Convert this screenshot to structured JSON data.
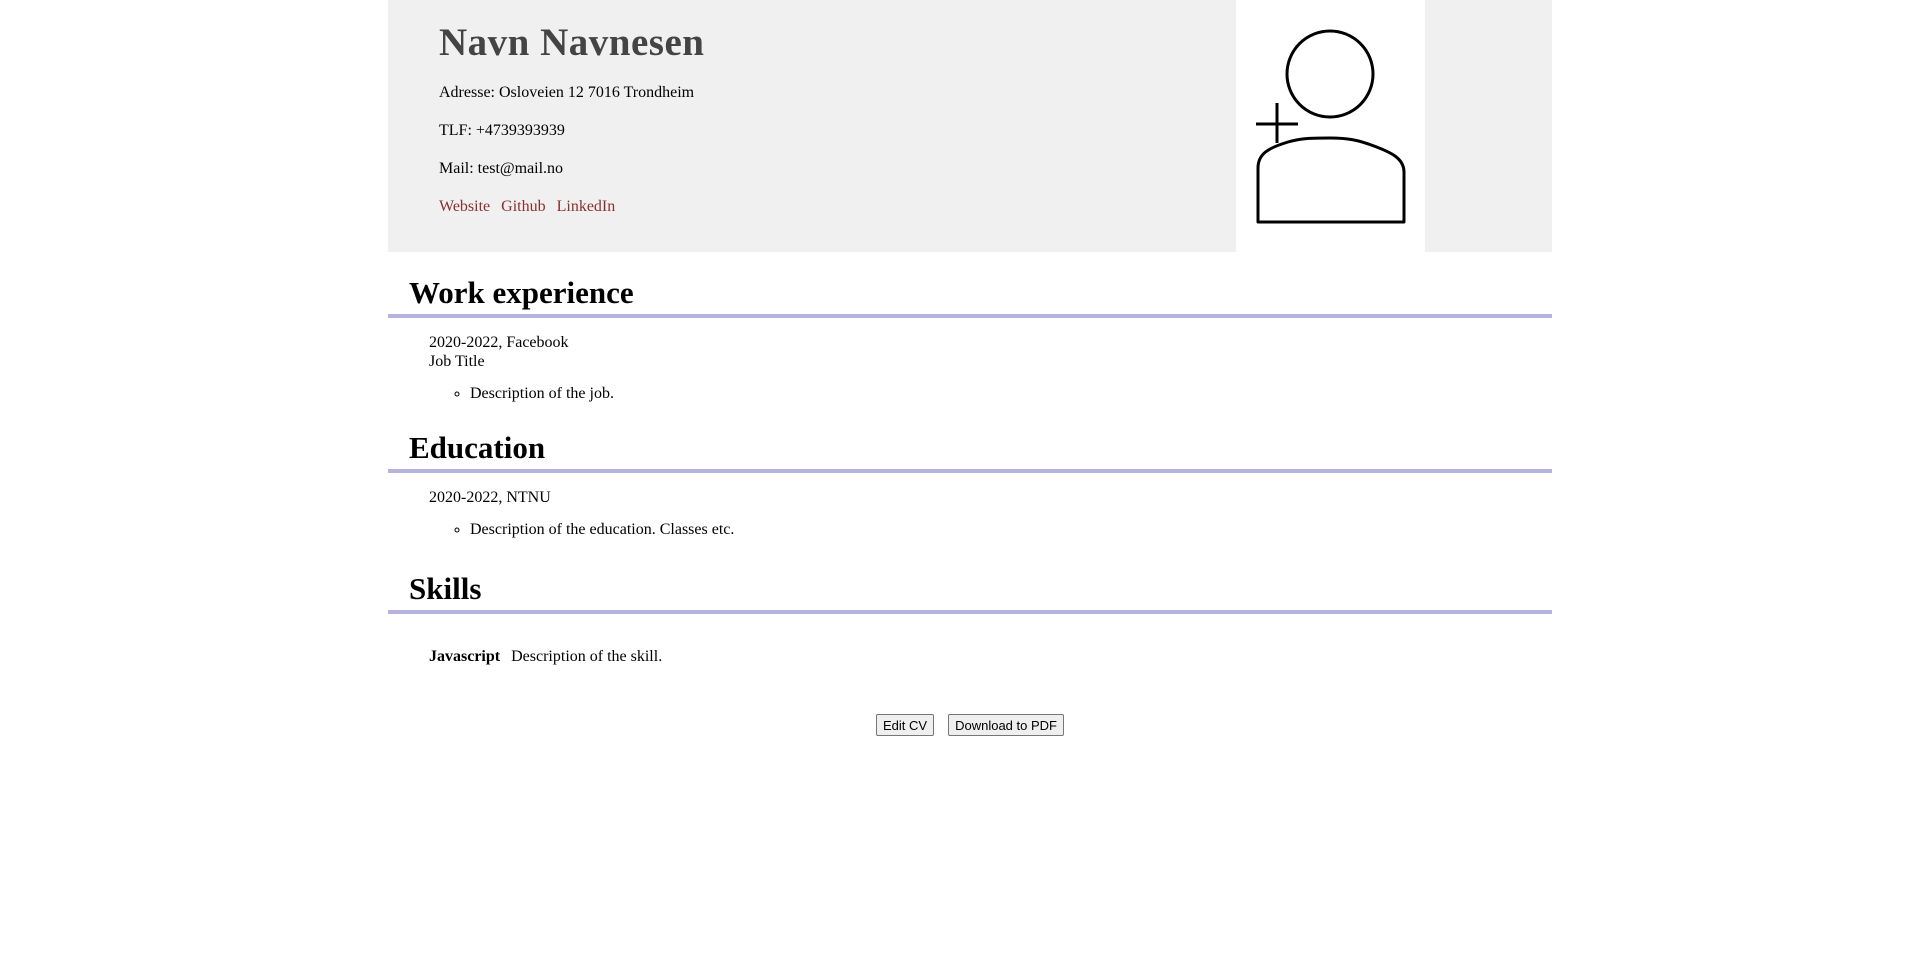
{
  "header": {
    "name": "Navn Navnesen",
    "address": "Adresse: Osloveien 12 7016 Trondheim",
    "phone": "TLF: +4739393939",
    "email": "Mail: test@mail.no",
    "links": [
      "Website",
      "Github",
      "LinkedIn"
    ]
  },
  "work": {
    "title": "Work experience",
    "entries": [
      {
        "period": "2020-2022, Facebook",
        "role": "Job Title",
        "description": "Description of the job."
      }
    ]
  },
  "education": {
    "title": "Education",
    "entries": [
      {
        "period": "2020-2022, NTNU",
        "description": "Description of the education. Classes etc."
      }
    ]
  },
  "skills": {
    "title": "Skills",
    "entries": [
      {
        "name": "Javascript",
        "description": "Description of the skill."
      }
    ]
  },
  "actions": {
    "edit_label": "Edit CV",
    "download_label": "Download to PDF"
  },
  "colors": {
    "header_bg": "#f0f0f0",
    "link": "#8b2f2f",
    "rule": "#b4b4de",
    "name": "#444444"
  },
  "icons": {
    "avatar": "add-user-icon"
  }
}
